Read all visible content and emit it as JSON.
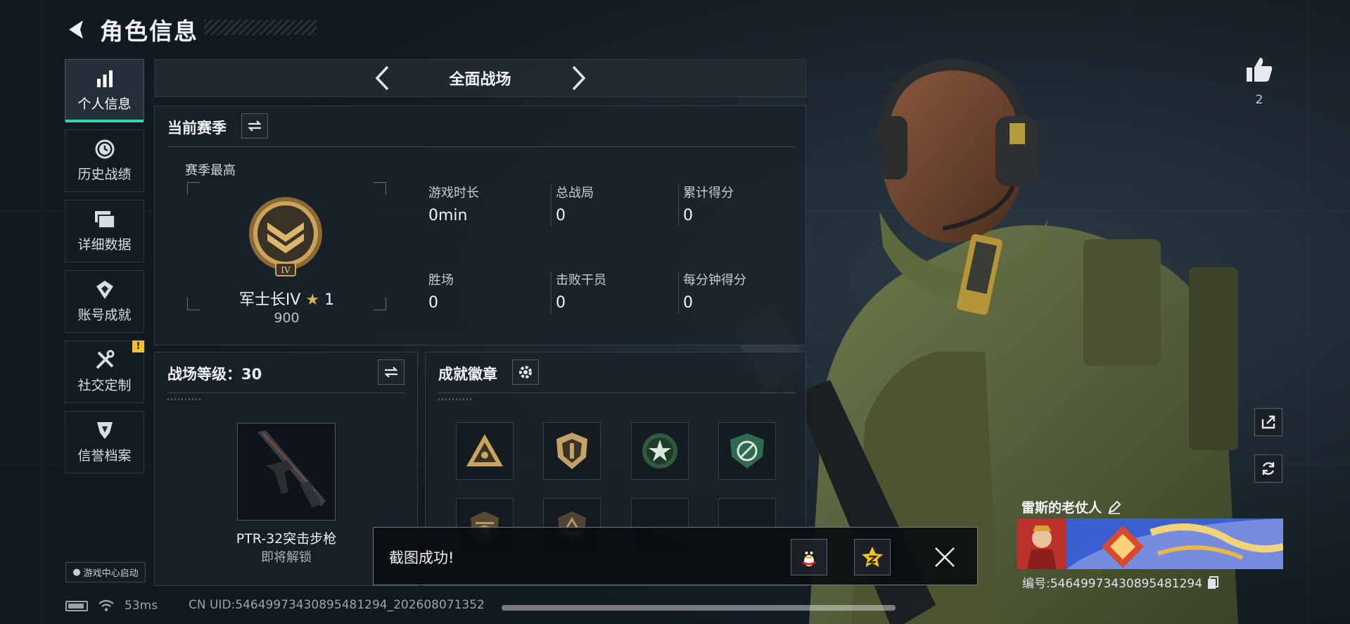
{
  "header": {
    "title": "角色信息"
  },
  "sidebar": {
    "items": [
      {
        "label": "个人信息",
        "icon": "bar-chart-icon",
        "active": true
      },
      {
        "label": "历史战绩",
        "icon": "clock-icon",
        "active": false
      },
      {
        "label": "详细数据",
        "icon": "folder-icon",
        "active": false
      },
      {
        "label": "账号成就",
        "icon": "achievement-icon",
        "active": false
      },
      {
        "label": "社交定制",
        "icon": "tools-icon",
        "active": false,
        "badge": "!"
      },
      {
        "label": "信誉档案",
        "icon": "credit-shield-icon",
        "active": false
      }
    ]
  },
  "mode_selector": {
    "label": "全面战场"
  },
  "season": {
    "title": "当前赛季",
    "best_label": "赛季最高",
    "rank_name": "军士长IV",
    "rank_stars": "1",
    "rank_points": "900",
    "emblem_numeral": "IV",
    "stats": [
      {
        "label": "游戏时长",
        "value": "0min"
      },
      {
        "label": "总战局",
        "value": "0"
      },
      {
        "label": "累计得分",
        "value": "0"
      },
      {
        "label": "胜场",
        "value": "0"
      },
      {
        "label": "击败干员",
        "value": "0"
      },
      {
        "label": "每分钟得分",
        "value": "0"
      }
    ]
  },
  "battlefield_level": {
    "title": "战场等级：30",
    "weapon_name": "PTR-32突击步枪",
    "weapon_status": "即将解锁"
  },
  "achievements": {
    "title": "成就徽章"
  },
  "game_center": {
    "label": "游戏中心启动"
  },
  "toast": {
    "message": "截图成功!"
  },
  "status": {
    "ping": "53ms",
    "uid": "CN UID:5464997343089548129​4_202608071352"
  },
  "player": {
    "name": "雷斯的老仗人",
    "id": "编号:54649973430895481294",
    "likes": "2"
  },
  "colors": {
    "accent": "#2fd8a4",
    "alert": "#f1c233",
    "gold": "#c9a45a"
  }
}
